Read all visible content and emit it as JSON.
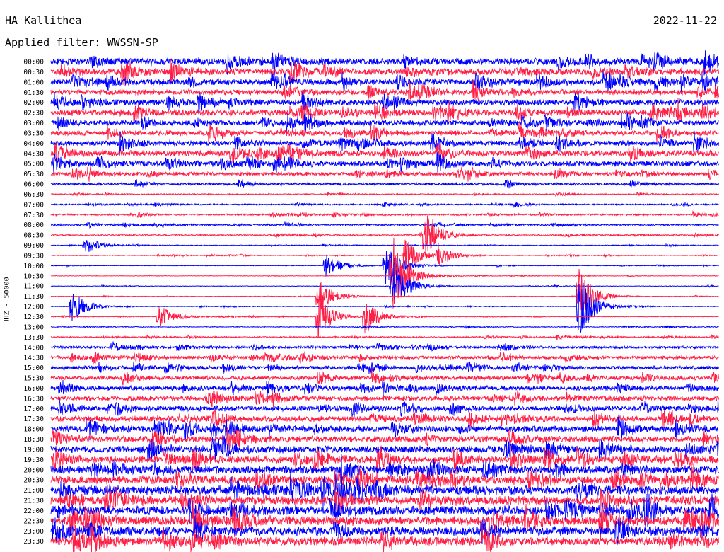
{
  "header": {
    "station": "HA Kallithea",
    "date": "2022-11-22",
    "filter": "Applied filter: WWSSN-SP"
  },
  "channel_label": "HHZ - 50000",
  "colors": {
    "trace_a": "#0000ff",
    "trace_b": "#ff1e46",
    "background": "#ffffff",
    "text": "#000000"
  },
  "chart_data": {
    "type": "line",
    "ylabel": "HHZ - 50000",
    "y_tick_labels": [
      "00:00",
      "00:30",
      "01:00",
      "01:30",
      "02:00",
      "02:30",
      "03:00",
      "03:30",
      "04:00",
      "04:30",
      "05:00",
      "05:30",
      "06:00",
      "06:30",
      "07:00",
      "07:30",
      "08:00",
      "08:30",
      "09:00",
      "09:30",
      "10:00",
      "10:30",
      "11:00",
      "11:30",
      "12:00",
      "12:30",
      "13:00",
      "13:30",
      "14:00",
      "14:30",
      "15:00",
      "15:30",
      "16:00",
      "16:30",
      "17:00",
      "17:30",
      "18:00",
      "18:30",
      "19:00",
      "19:30",
      "20:00",
      "20:30",
      "21:00",
      "21:30",
      "22:00",
      "22:30",
      "23:00",
      "23:30"
    ],
    "trace_colors_alternating": [
      "#0000ff",
      "#ff1e46"
    ],
    "relative_amplitude": [
      2.6,
      2.5,
      2.2,
      2.1,
      2.2,
      2.3,
      2.0,
      1.9,
      2.1,
      2.3,
      2.1,
      1.4,
      0.9,
      0.45,
      0.55,
      0.65,
      0.6,
      0.5,
      0.3,
      0.25,
      0.22,
      0.2,
      0.2,
      0.2,
      0.22,
      0.25,
      0.3,
      0.5,
      1.0,
      1.3,
      1.4,
      1.5,
      1.7,
      1.9,
      2.0,
      2.2,
      2.3,
      2.4,
      2.6,
      2.8,
      3.0,
      3.2,
      3.4,
      3.5,
      3.5,
      3.4,
      3.4,
      3.3
    ],
    "events": [
      {
        "label": "08:30",
        "x": 0.56,
        "scale": 6
      },
      {
        "label": "09:00",
        "x": 0.05,
        "scale": 2
      },
      {
        "label": "09:30",
        "x": 0.58,
        "scale": 2.5
      },
      {
        "label": "09:30",
        "x": 0.53,
        "scale": 4
      },
      {
        "label": "10:00",
        "x": 0.5,
        "scale": 5
      },
      {
        "label": "10:00",
        "x": 0.41,
        "scale": 3
      },
      {
        "label": "10:30",
        "x": 0.51,
        "scale": 10
      },
      {
        "label": "11:00",
        "x": 0.51,
        "scale": 7
      },
      {
        "label": "11:30",
        "x": 0.4,
        "scale": 4
      },
      {
        "label": "11:30",
        "x": 0.79,
        "scale": 7
      },
      {
        "label": "12:00",
        "x": 0.03,
        "scale": 4
      },
      {
        "label": "12:00",
        "x": 0.79,
        "scale": 8
      },
      {
        "label": "12:30",
        "x": 0.4,
        "scale": 5
      },
      {
        "label": "12:30",
        "x": 0.47,
        "scale": 4
      },
      {
        "label": "12:30",
        "x": 0.16,
        "scale": 3
      }
    ]
  }
}
